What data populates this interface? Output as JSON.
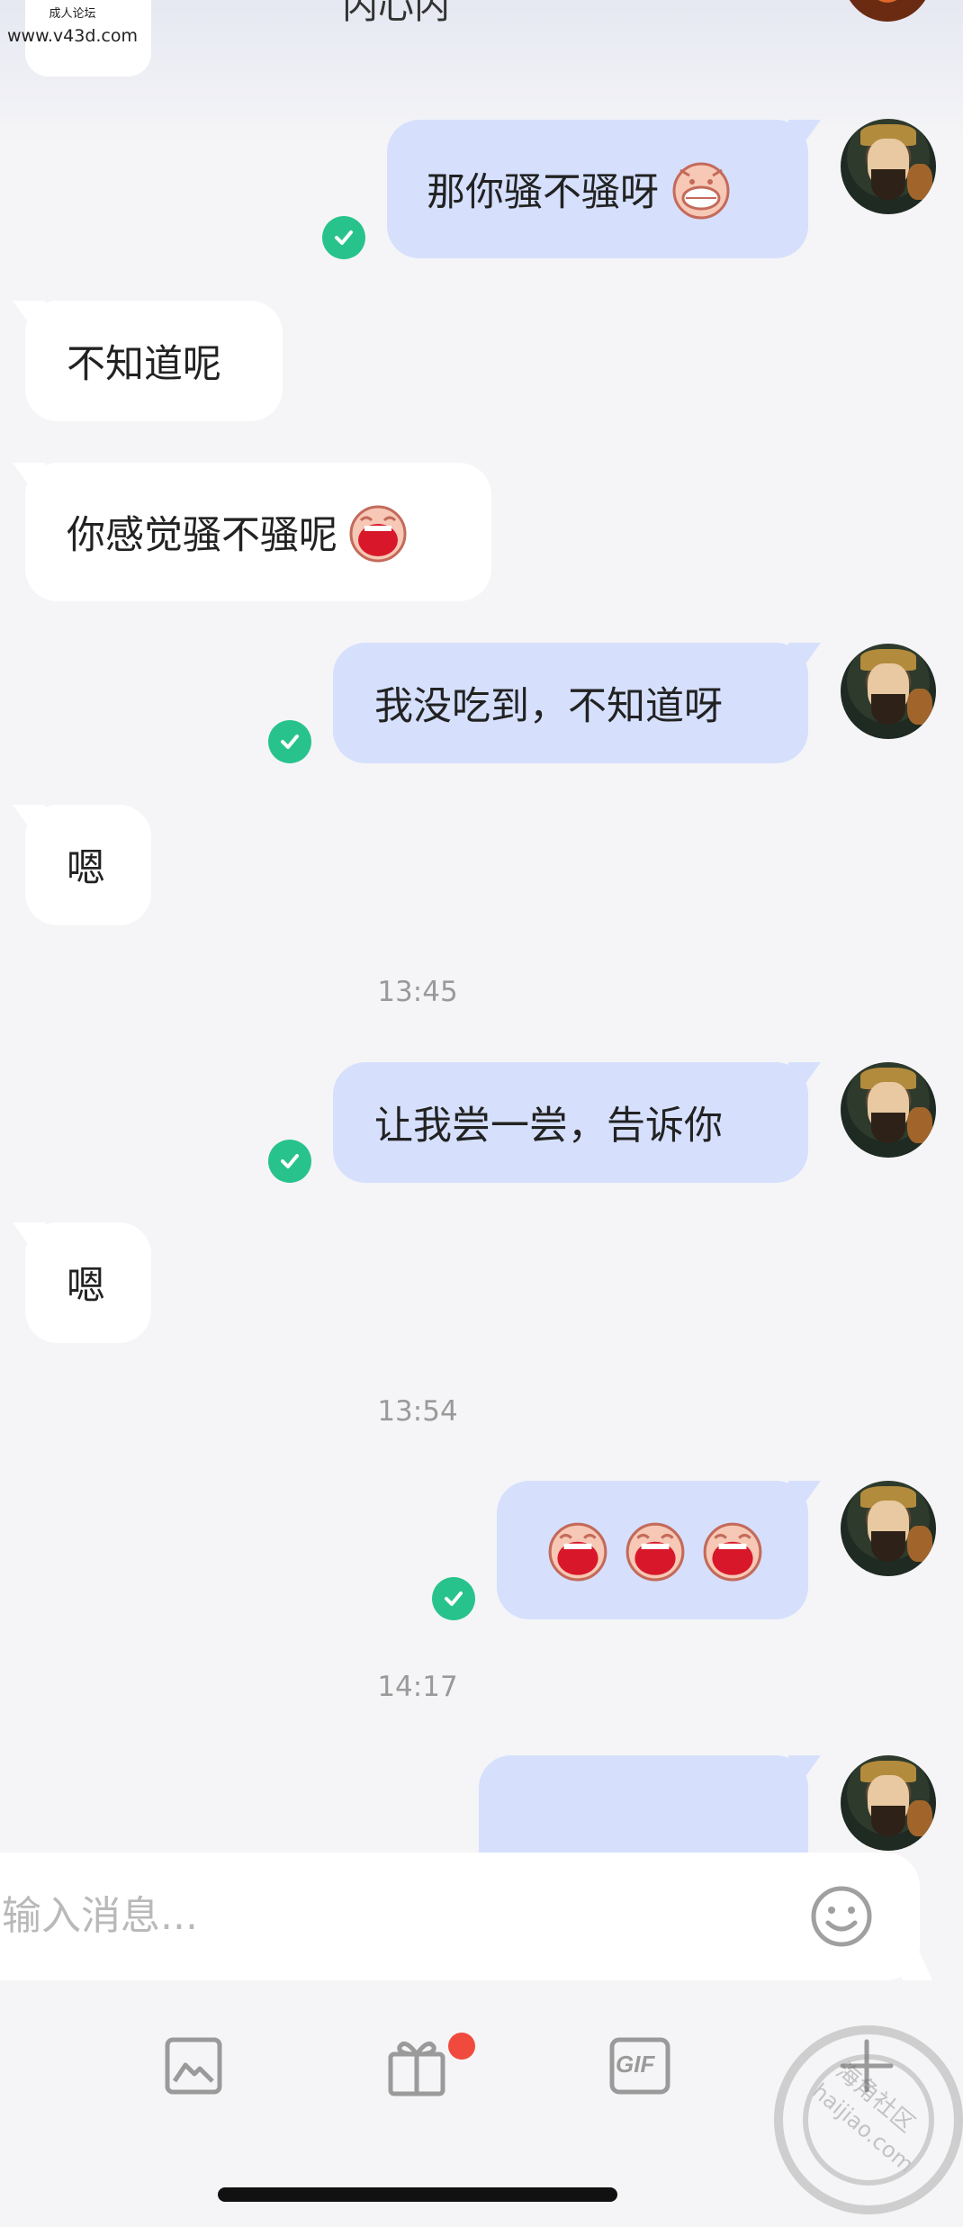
{
  "watermark": {
    "small": "成人论坛",
    "url": "www.v43d.com"
  },
  "header": {
    "title_cut": "内心内"
  },
  "messages": [
    {
      "side": "out",
      "text": "那你骚不骚呀",
      "emoji": "grin-pig",
      "read": true
    },
    {
      "side": "in",
      "text": "不知道呢"
    },
    {
      "side": "in",
      "text": "你感觉骚不骚呢",
      "emoji": "laugh-pig"
    },
    {
      "side": "out",
      "text": "我没吃到，不知道呀",
      "read": true
    },
    {
      "side": "in",
      "text": "嗯"
    },
    {
      "side": "time",
      "text": "13:45"
    },
    {
      "side": "out",
      "text": "让我尝一尝，告诉你",
      "read": true
    },
    {
      "side": "in",
      "text": "嗯"
    },
    {
      "side": "time",
      "text": "13:54"
    },
    {
      "side": "out",
      "text": "",
      "emoji_row": [
        "laugh-pig",
        "laugh-pig",
        "laugh-pig"
      ],
      "read": true
    },
    {
      "side": "time",
      "text": "14:17"
    }
  ],
  "composer": {
    "placeholder": "输入消息..."
  },
  "toolbar": {
    "items": [
      "image-icon",
      "gift-icon",
      "gif-icon",
      "plus-icon"
    ],
    "gif_label": "GIF",
    "gift_badge": true
  },
  "corner_watermark": {
    "text_cn": "海角社区",
    "text_en": "haijiao.com"
  },
  "colors": {
    "outgoing_bubble": "#d6e0fd",
    "incoming_bubble": "#ffffff",
    "read_check": "#28c38c",
    "badge": "#f04a3e"
  }
}
